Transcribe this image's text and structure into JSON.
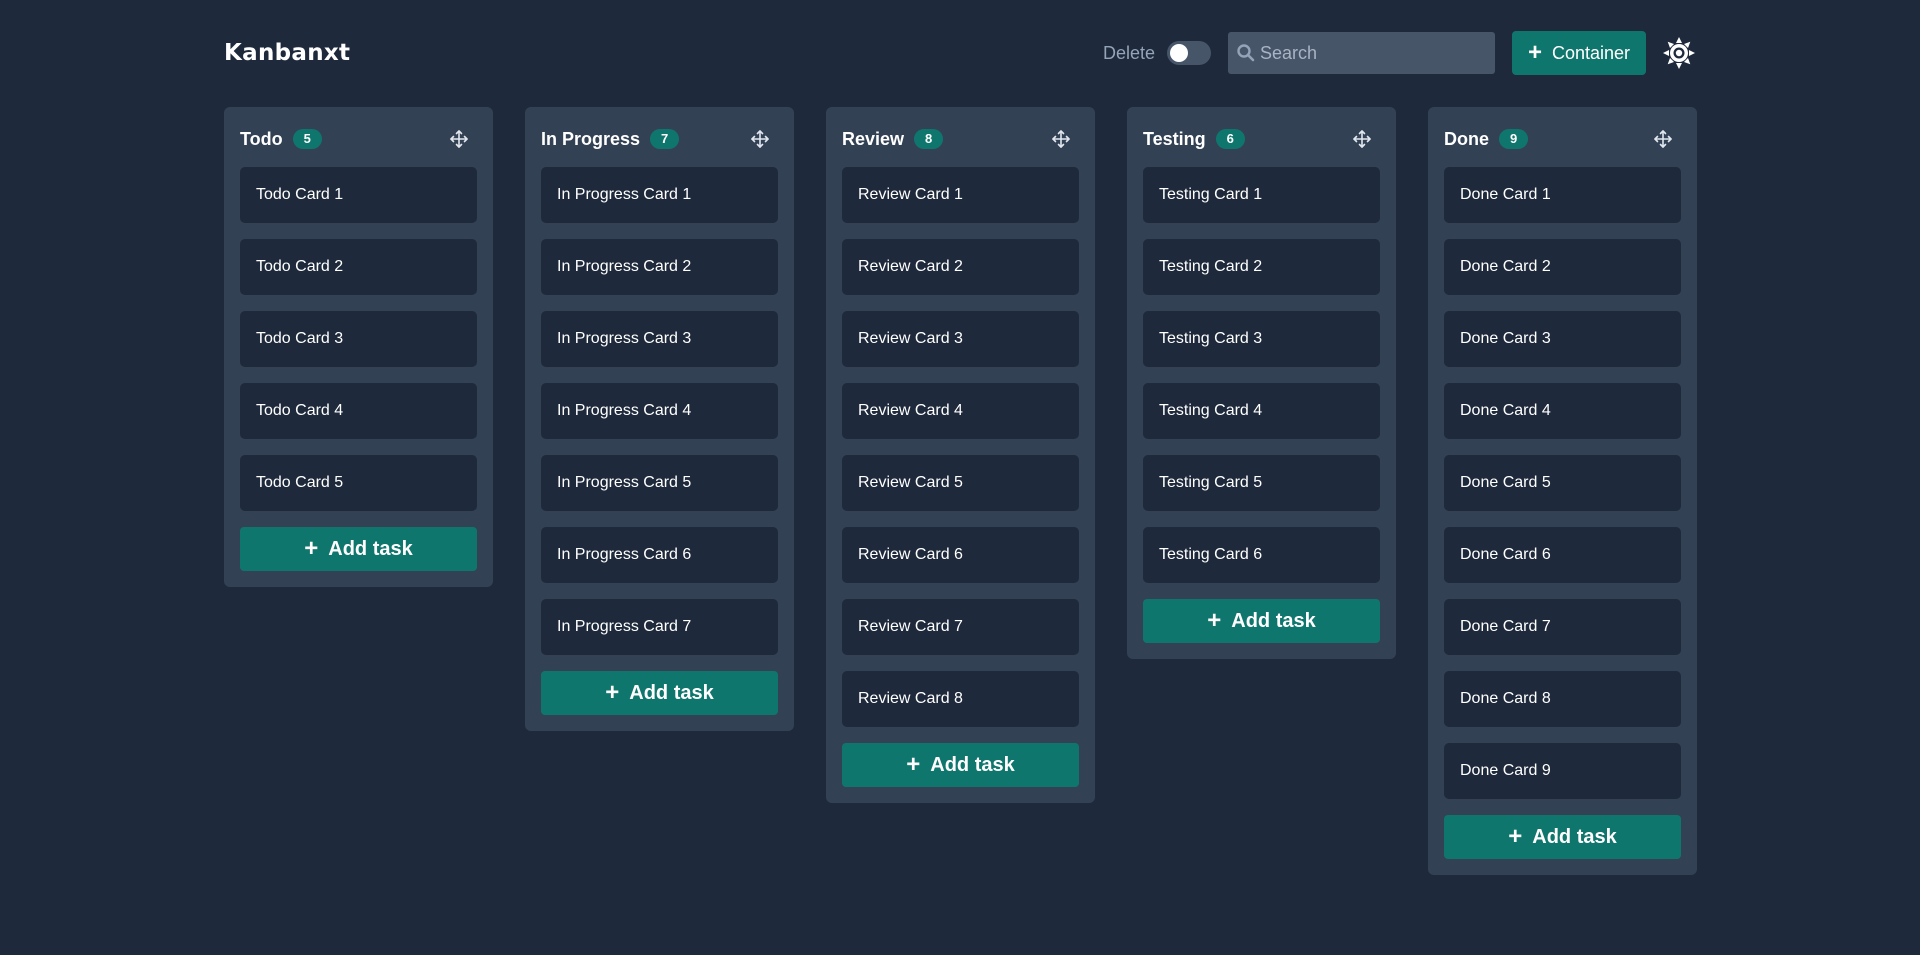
{
  "header": {
    "app_title": "Kanbanxt",
    "delete_label": "Delete",
    "delete_toggle_on": false,
    "search_placeholder": "Search",
    "search_value": "",
    "container_button_label": "Container",
    "container_button_icon": "plus-icon",
    "theme_icon": "sun-icon"
  },
  "colors": {
    "background": "#1e293b",
    "column": "#334155",
    "card": "#1e293b",
    "accent": "#0f766e"
  },
  "add_task_label": "Add task",
  "columns": [
    {
      "title": "Todo",
      "count": "5",
      "cards": [
        "Todo Card 1",
        "Todo Card 2",
        "Todo Card 3",
        "Todo Card 4",
        "Todo Card 5"
      ]
    },
    {
      "title": "In Progress",
      "count": "7",
      "cards": [
        "In Progress Card 1",
        "In Progress Card 2",
        "In Progress Card 3",
        "In Progress Card 4",
        "In Progress Card 5",
        "In Progress Card 6",
        "In Progress Card 7"
      ]
    },
    {
      "title": "Review",
      "count": "8",
      "cards": [
        "Review Card 1",
        "Review Card 2",
        "Review Card 3",
        "Review Card 4",
        "Review Card 5",
        "Review Card 6",
        "Review Card 7",
        "Review Card 8"
      ]
    },
    {
      "title": "Testing",
      "count": "6",
      "cards": [
        "Testing Card 1",
        "Testing Card 2",
        "Testing Card 3",
        "Testing Card 4",
        "Testing Card 5",
        "Testing Card 6"
      ]
    },
    {
      "title": "Done",
      "count": "9",
      "cards": [
        "Done Card 1",
        "Done Card 2",
        "Done Card 3",
        "Done Card 4",
        "Done Card 5",
        "Done Card 6",
        "Done Card 7",
        "Done Card 8",
        "Done Card 9"
      ]
    }
  ]
}
